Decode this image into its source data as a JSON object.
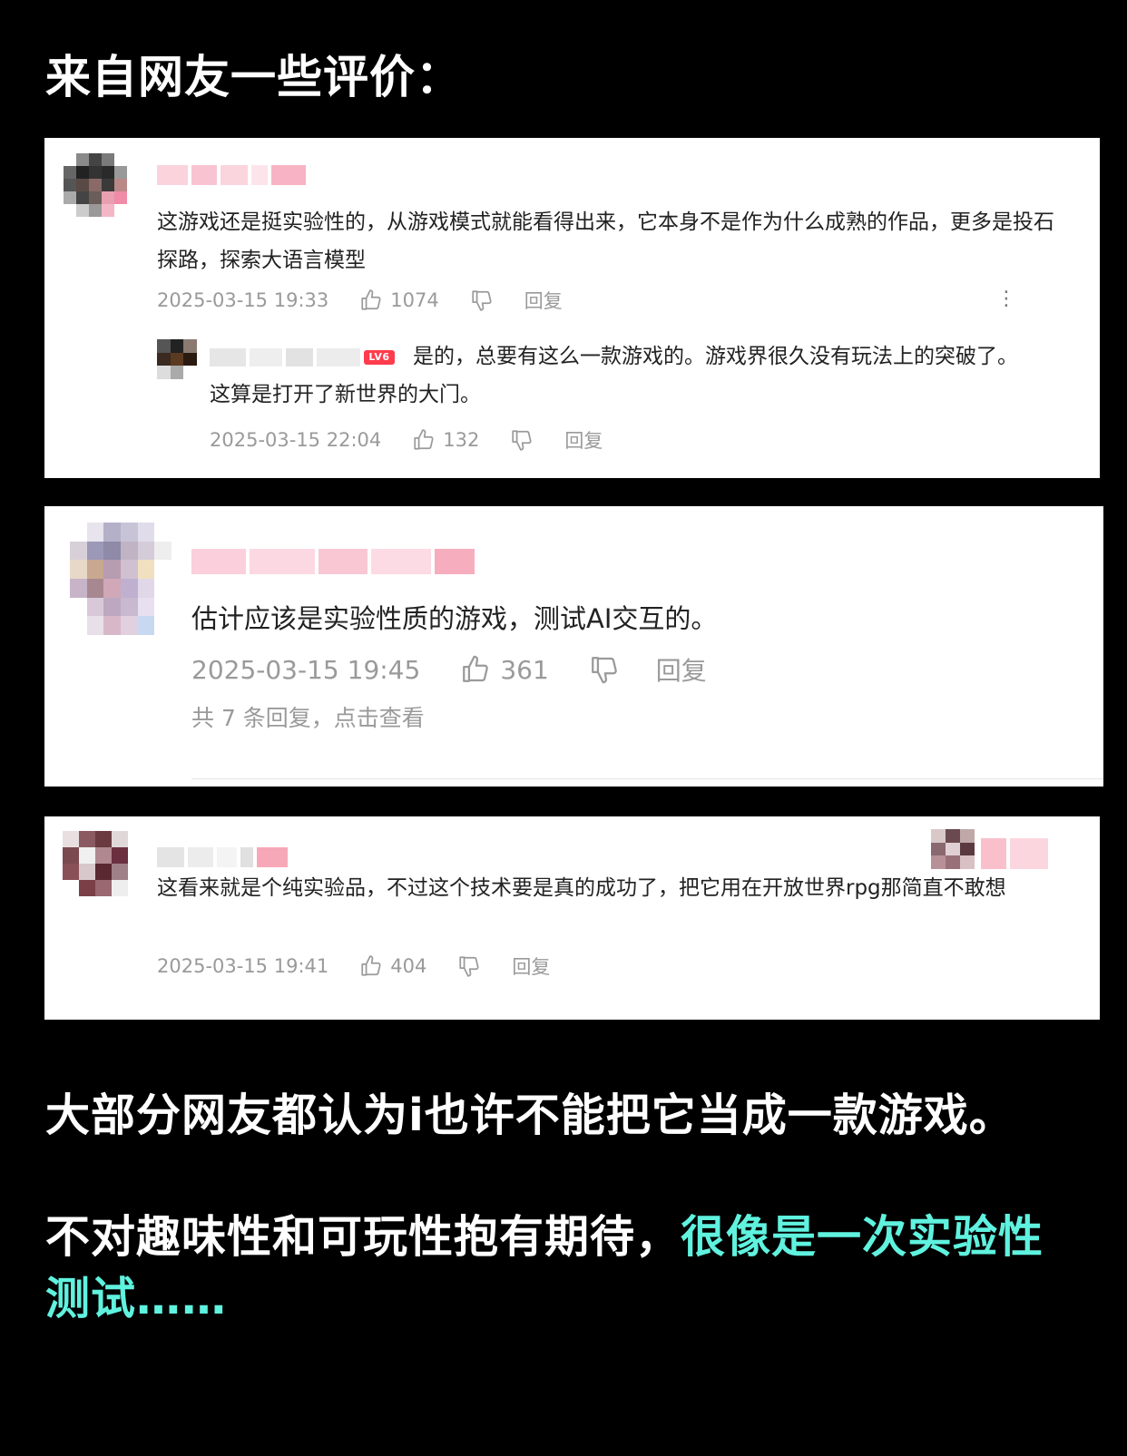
{
  "heading": "来自网友一些评价：",
  "comments": [
    {
      "text": "这游戏还是挺实验性的，从游戏模式就能看得出来，它本身不是作为什么成熟的作品，更多是投石探路，探索大语言模型",
      "date": "2025-03-15 19:33",
      "likes": "1074",
      "reply_label": "回复",
      "reply": {
        "level_badge": "LV6",
        "text": "是的，总要有这么一款游戏的。游戏界很久没有玩法上的突破了。这算是打开了新世界的大门。",
        "date": "2025-03-15 22:04",
        "likes": "132",
        "reply_label": "回复"
      }
    },
    {
      "text": "估计应该是实验性质的游戏，测试AI交互的。",
      "date": "2025-03-15 19:45",
      "likes": "361",
      "reply_label": "回复",
      "view_replies": "共 7 条回复，点击查看"
    },
    {
      "text": "这看来就是个纯实验品，不过这个技术要是真的成功了，把它用在开放世界rpg那简直不敢想",
      "date": "2025-03-15 19:41",
      "likes": "404",
      "reply_label": "回复"
    }
  ],
  "summary": {
    "line1": "大部分网友都认为i也许不能把它当成一款游戏。",
    "line2_white": "不对趣味性和可玩性抱有期待，",
    "line2_accent": "很像是一次实验性测试……"
  },
  "colors": {
    "background": "#000000",
    "card": "#ffffff",
    "accent": "#5ff2df",
    "meta_text": "#9a9a9a",
    "badge": "#ff3b4c"
  },
  "icons": [
    "thumbs-up-icon",
    "thumbs-down-icon",
    "more-icon"
  ]
}
